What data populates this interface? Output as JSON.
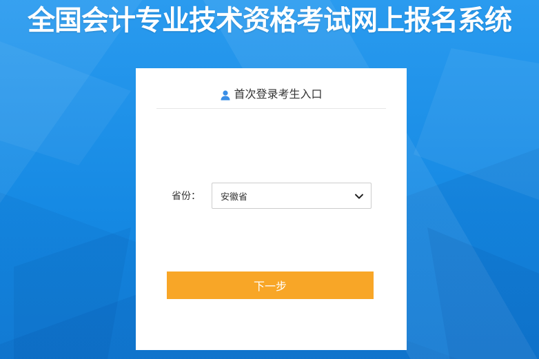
{
  "header": {
    "title": "全国会计专业技术资格考试网上报名系统"
  },
  "login_card": {
    "title": "首次登录考生入口",
    "icon": "user-icon",
    "province_label": "省份：",
    "province_selected": "安徽省",
    "next_button_label": "下一步"
  },
  "colors": {
    "background": "#1a8fe6",
    "button": "#f8a627",
    "icon": "#3a8ee6"
  }
}
